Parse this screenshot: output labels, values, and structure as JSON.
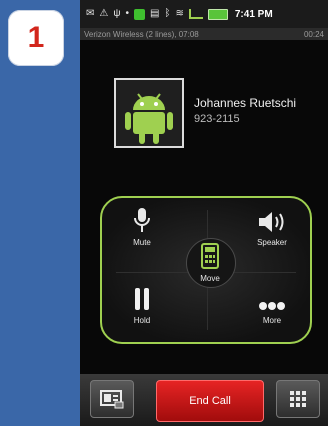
{
  "step": {
    "number": "1"
  },
  "status_bar": {
    "time": "7:41 PM"
  },
  "sub_bar": {
    "left_text": "Verizon Wireless (2 lines), 07:08",
    "right_text": "00:24"
  },
  "contact": {
    "name": "Johannes Ruetschi",
    "number": "923-2115"
  },
  "controls": {
    "mute_label": "Mute",
    "speaker_label": "Speaker",
    "merge_label": "Move",
    "hold_label": "Hold",
    "more_label": "More"
  },
  "bottom": {
    "end_call_label": "End Call"
  },
  "colors": {
    "accent": "#9fd050",
    "end_call": "#d01515",
    "page_bg": "#3a67a8"
  }
}
